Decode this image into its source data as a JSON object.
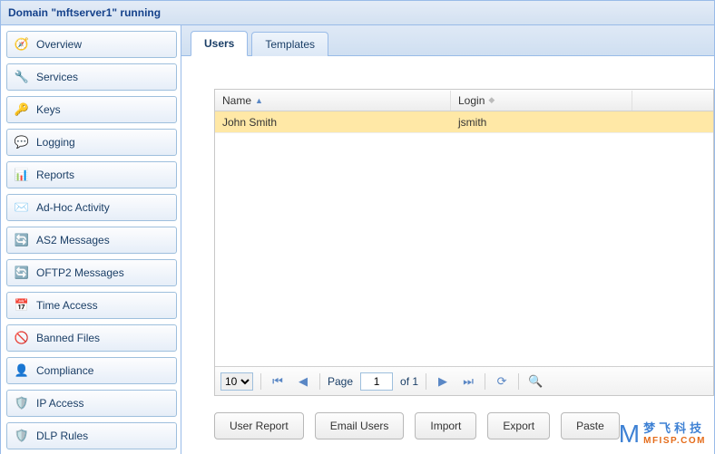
{
  "header": {
    "title": "Domain \"mftserver1\" running"
  },
  "sidebar": {
    "items": [
      {
        "label": "Overview",
        "icon": "🧭"
      },
      {
        "label": "Services",
        "icon": "🔧"
      },
      {
        "label": "Keys",
        "icon": "🔑"
      },
      {
        "label": "Logging",
        "icon": "💬"
      },
      {
        "label": "Reports",
        "icon": "📊"
      },
      {
        "label": "Ad-Hoc Activity",
        "icon": "✉️"
      },
      {
        "label": "AS2 Messages",
        "icon": "🔄"
      },
      {
        "label": "OFTP2 Messages",
        "icon": "🔄"
      },
      {
        "label": "Time Access",
        "icon": "📅"
      },
      {
        "label": "Banned Files",
        "icon": "🚫"
      },
      {
        "label": "Compliance",
        "icon": "👤"
      },
      {
        "label": "IP Access",
        "icon": "🛡️"
      },
      {
        "label": "DLP Rules",
        "icon": "🛡️"
      }
    ]
  },
  "tabs": [
    {
      "label": "Users",
      "active": true
    },
    {
      "label": "Templates",
      "active": false
    }
  ],
  "table": {
    "columns": [
      {
        "label": "Name",
        "sort": "asc"
      },
      {
        "label": "Login",
        "sort": "none"
      }
    ],
    "rows": [
      {
        "name": "John Smith",
        "login": "jsmith",
        "selected": true
      }
    ]
  },
  "pager": {
    "page_size": "10",
    "page_label": "Page",
    "page": "1",
    "of_label": "of 1"
  },
  "buttons": {
    "user_report": "User Report",
    "email_users": "Email Users",
    "import": "Import",
    "export": "Export",
    "paste": "Paste"
  },
  "watermark": {
    "logo": "M",
    "cn": "梦飞科技",
    "url": "MFISP.COM"
  }
}
